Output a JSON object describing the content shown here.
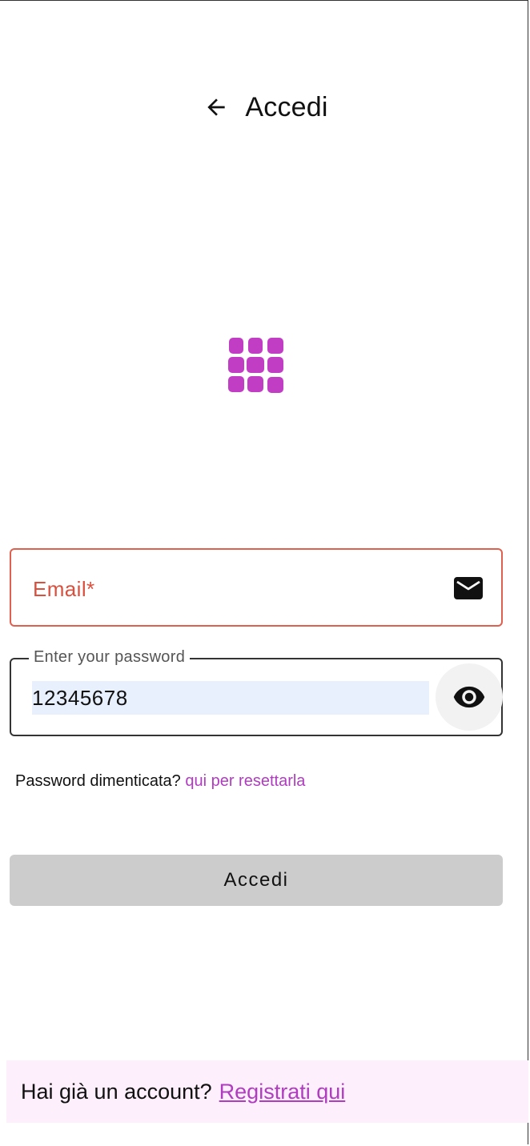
{
  "header": {
    "title": "Accedi",
    "back_icon": "arrow-left-icon"
  },
  "logo": {
    "icon": "grid-logo-icon",
    "color": "#c13ec4"
  },
  "email": {
    "label": "Email*",
    "icon": "mail-icon",
    "error_color": "#d9503e"
  },
  "password": {
    "legend": "Enter your password",
    "value": "12345678",
    "toggle_icon": "eye-icon"
  },
  "forgot": {
    "text": "Password dimenticata?",
    "link": "qui per resettarla"
  },
  "submit": {
    "label": "Accedi"
  },
  "footer": {
    "text": "Hai già un account?",
    "link": "Registrati qui"
  },
  "colors": {
    "accent": "#b03cc0",
    "footer_bg": "#fdf0fc",
    "button_bg": "#cccccc"
  }
}
